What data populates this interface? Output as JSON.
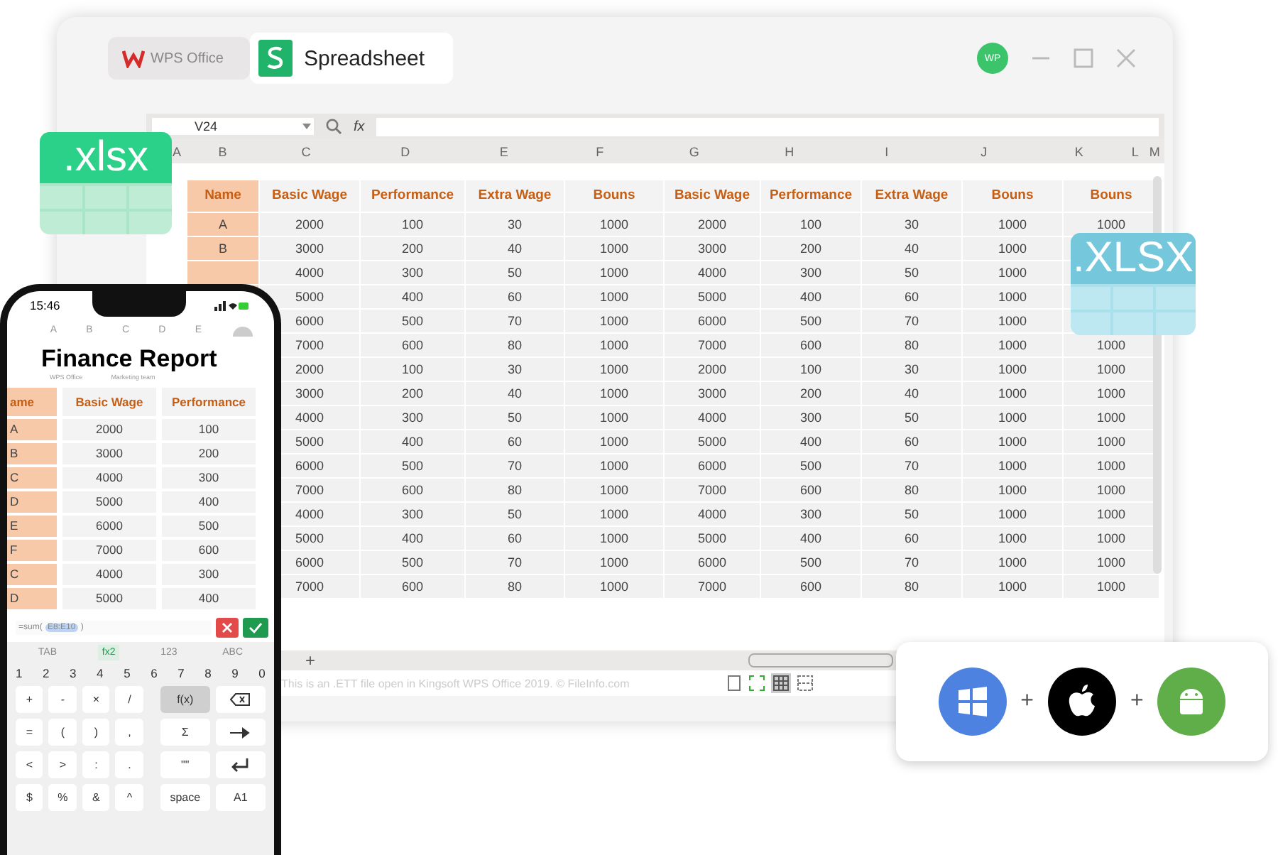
{
  "window": {
    "app_tab": "WPS Office",
    "doc_tab": "Spreadsheet",
    "avatar": "WP"
  },
  "formula_bar": {
    "cell_ref": "V24",
    "fx": "fx"
  },
  "column_letters": [
    "A",
    "B",
    "C",
    "D",
    "E",
    "F",
    "G",
    "H",
    "I",
    "J",
    "K",
    "L",
    "M"
  ],
  "table": {
    "columns": [
      "Name",
      "Basic Wage",
      "Performance",
      "Extra Wage",
      "Bouns",
      "Basic Wage",
      "Performance",
      "Extra Wage",
      "Bouns",
      "Bouns"
    ],
    "rows": [
      [
        "A",
        "2000",
        "100",
        "30",
        "1000",
        "2000",
        "100",
        "30",
        "1000",
        "1000"
      ],
      [
        "B",
        "3000",
        "200",
        "40",
        "1000",
        "3000",
        "200",
        "40",
        "1000",
        null
      ],
      [
        null,
        "4000",
        "300",
        "50",
        "1000",
        "4000",
        "300",
        "50",
        "1000",
        null
      ],
      [
        null,
        "5000",
        "400",
        "60",
        "1000",
        "5000",
        "400",
        "60",
        "1000",
        null
      ],
      [
        null,
        "6000",
        "500",
        "70",
        "1000",
        "6000",
        "500",
        "70",
        "1000",
        null
      ],
      [
        null,
        "7000",
        "600",
        "80",
        "1000",
        "7000",
        "600",
        "80",
        "1000",
        "1000"
      ],
      [
        null,
        "2000",
        "100",
        "30",
        "1000",
        "2000",
        "100",
        "30",
        "1000",
        "1000"
      ],
      [
        null,
        "3000",
        "200",
        "40",
        "1000",
        "3000",
        "200",
        "40",
        "1000",
        "1000"
      ],
      [
        null,
        "4000",
        "300",
        "50",
        "1000",
        "4000",
        "300",
        "50",
        "1000",
        "1000"
      ],
      [
        null,
        "5000",
        "400",
        "60",
        "1000",
        "5000",
        "400",
        "60",
        "1000",
        "1000"
      ],
      [
        null,
        "6000",
        "500",
        "70",
        "1000",
        "6000",
        "500",
        "70",
        "1000",
        "1000"
      ],
      [
        null,
        "7000",
        "600",
        "80",
        "1000",
        "7000",
        "600",
        "80",
        "1000",
        "1000"
      ],
      [
        null,
        "4000",
        "300",
        "50",
        "1000",
        "4000",
        "300",
        "50",
        "1000",
        "1000"
      ],
      [
        null,
        "5000",
        "400",
        "60",
        "1000",
        "5000",
        "400",
        "60",
        "1000",
        "1000"
      ],
      [
        null,
        "6000",
        "500",
        "70",
        "1000",
        "6000",
        "500",
        "70",
        "1000",
        "1000"
      ],
      [
        null,
        "7000",
        "600",
        "80",
        "1000",
        "7000",
        "600",
        "80",
        "1000",
        "1000"
      ]
    ]
  },
  "sheet_tabs": {
    "add": "+"
  },
  "status_bar": "This is an .ETT file open in Kingsoft WPS Office 2019. © FileInfo.com",
  "badges": [
    {
      "text": ".xlsx",
      "kind": "green"
    },
    {
      "text": ".XLSX",
      "kind": "blue"
    }
  ],
  "phone": {
    "time": "15:46",
    "column_letters": [
      "A",
      "B",
      "C",
      "D",
      "E"
    ],
    "title": "Finance Report",
    "subtitles": [
      "WPS Office",
      "Marketing team"
    ],
    "columns": [
      "ame",
      "Basic Wage",
      "Performance"
    ],
    "rows": [
      [
        "A",
        "2000",
        "100"
      ],
      [
        "B",
        "3000",
        "200"
      ],
      [
        "C",
        "4000",
        "300"
      ],
      [
        "D",
        "5000",
        "400"
      ],
      [
        "E",
        "6000",
        "500"
      ],
      [
        "F",
        "7000",
        "600"
      ],
      [
        "C",
        "4000",
        "300"
      ],
      [
        "D",
        "5000",
        "400"
      ]
    ],
    "formula": {
      "prefix": "=sum(",
      "ref": "E8:E10",
      "suffix": ")"
    },
    "modes": [
      {
        "label": "TAB",
        "selected": false
      },
      {
        "label": "fx2",
        "selected": true
      },
      {
        "label": "123",
        "selected": false
      },
      {
        "label": "ABC",
        "selected": false
      }
    ],
    "digits": [
      "1",
      "2",
      "3",
      "4",
      "5",
      "6",
      "7",
      "8",
      "9",
      "0"
    ],
    "keys": [
      [
        "+",
        "-",
        "×",
        "/"
      ],
      [
        "=",
        "(",
        ")",
        ","
      ],
      [
        "<",
        ">",
        ":",
        "."
      ],
      [
        "$",
        "%",
        "&",
        "^"
      ]
    ],
    "side_keys": [
      [
        {
          "label": "f(x)",
          "selected": true
        },
        {
          "kind": "backspace"
        }
      ],
      [
        {
          "label": "Σ",
          "selected": false
        },
        {
          "kind": "arrow"
        }
      ],
      [
        {
          "label": "\"\"",
          "selected": false
        },
        {
          "kind": "enter"
        }
      ],
      [
        {
          "label": "space",
          "selected": false
        },
        {
          "label": "A1",
          "selected": false
        }
      ]
    ]
  },
  "platforms": [
    {
      "kind": "windows",
      "plus": "+"
    },
    {
      "kind": "apple",
      "plus": "+"
    },
    {
      "kind": "android"
    }
  ]
}
